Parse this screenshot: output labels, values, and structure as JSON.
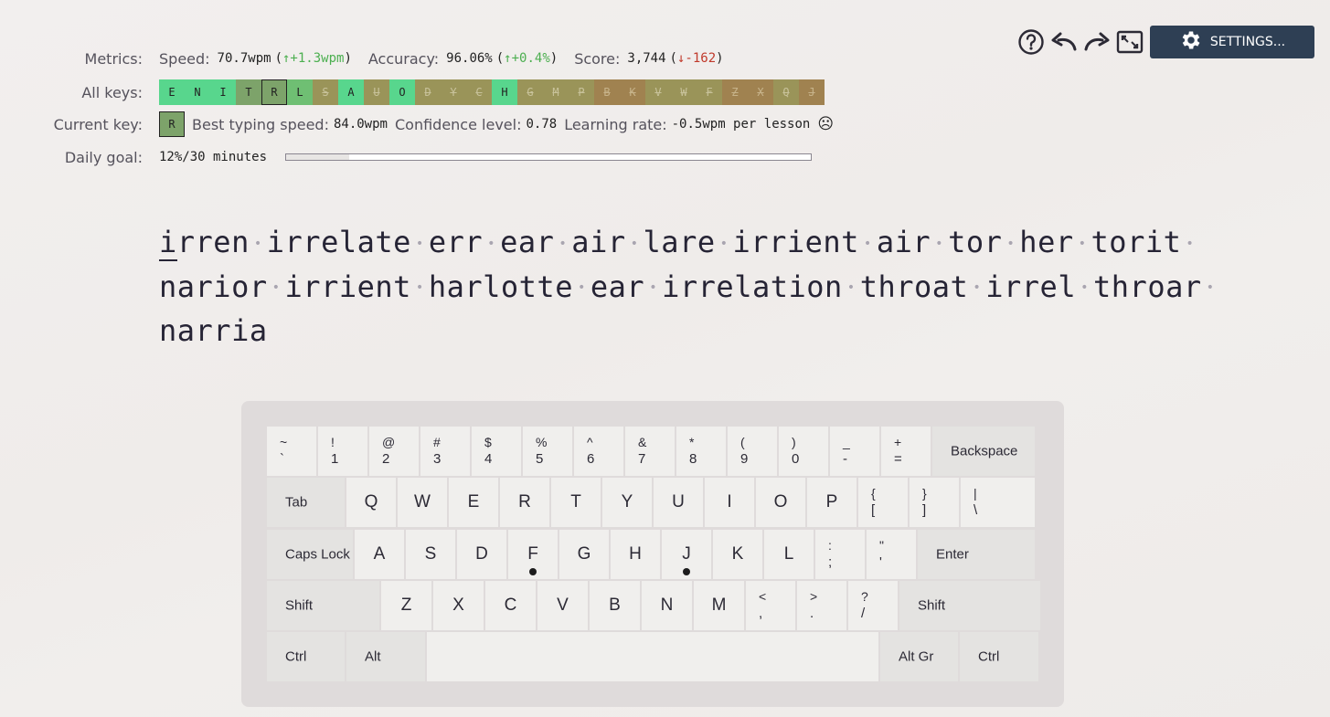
{
  "toolbar": {
    "help_icon": "question-circle-icon",
    "undo_icon": "undo-icon",
    "redo_icon": "redo-icon",
    "fullscreen_icon": "fullscreen-icon",
    "settings_label": "SETTINGS..."
  },
  "metrics": {
    "label": "Metrics:",
    "speed_label": "Speed:",
    "speed_value": "70.7wpm",
    "speed_delta": "↑+1.3wpm",
    "accuracy_label": "Accuracy:",
    "accuracy_value": "96.06%",
    "accuracy_delta": "↑+0.4%",
    "score_label": "Score:",
    "score_value": "3,744",
    "score_delta": "↓-162",
    "open_paren": "(",
    "close_paren": ")"
  },
  "all_keys": {
    "label": "All keys:",
    "keys": [
      "E",
      "N",
      "I",
      "T",
      "R",
      "L",
      "S",
      "A",
      "U",
      "O",
      "D",
      "Y",
      "C",
      "H",
      "G",
      "M",
      "P",
      "B",
      "K",
      "V",
      "W",
      "F",
      "Z",
      "X",
      "Q",
      "J"
    ]
  },
  "current_key": {
    "label": "Current key:",
    "key": "R",
    "best_speed_label": "Best typing speed:",
    "best_speed_value": "84.0wpm",
    "confidence_label": "Confidence level:",
    "confidence_value": "0.78",
    "learning_rate_label": "Learning rate:",
    "learning_rate_value": "-0.5wpm per lesson",
    "mood_icon": "☹"
  },
  "daily_goal": {
    "label": "Daily goal:",
    "value": "12%/30 minutes",
    "progress_fraction": 0.12
  },
  "lesson_text": {
    "line1": [
      "irren",
      "irrelate",
      "err",
      "ear",
      "air",
      "lare",
      "irrient",
      "air",
      "tor",
      "her",
      "torit"
    ],
    "line2": [
      "narior",
      "irrient",
      "harlotte",
      "ear",
      "irrelation",
      "throat",
      "irrel",
      "throar"
    ],
    "line3": [
      "narria"
    ],
    "separator": "•"
  },
  "keyboard": {
    "row1": [
      {
        "top": "~",
        "bot": "`"
      },
      {
        "top": "!",
        "bot": "1"
      },
      {
        "top": "@",
        "bot": "2"
      },
      {
        "top": "#",
        "bot": "3"
      },
      {
        "top": "$",
        "bot": "4"
      },
      {
        "top": "%",
        "bot": "5"
      },
      {
        "top": "^",
        "bot": "6"
      },
      {
        "top": "&",
        "bot": "7"
      },
      {
        "top": "*",
        "bot": "8"
      },
      {
        "top": "(",
        "bot": "9"
      },
      {
        "top": ")",
        "bot": "0"
      },
      {
        "top": "_",
        "bot": "-"
      },
      {
        "top": "+",
        "bot": "="
      }
    ],
    "backspace": "Backspace",
    "tab": "Tab",
    "row2": [
      "Q",
      "W",
      "E",
      "R",
      "T",
      "Y",
      "U",
      "I",
      "O",
      "P"
    ],
    "row2_sym": [
      {
        "top": "{",
        "bot": "["
      },
      {
        "top": "}",
        "bot": "]"
      },
      {
        "top": "|",
        "bot": "\\"
      }
    ],
    "caps": "Caps Lock",
    "row3": [
      "A",
      "S",
      "D",
      "F",
      "G",
      "H",
      "J",
      "K",
      "L"
    ],
    "row3_sym": [
      {
        "top": ":",
        "bot": ";"
      },
      {
        "top": "\"",
        "bot": "'"
      }
    ],
    "enter": "Enter",
    "shift_left": "Shift",
    "row4": [
      "Z",
      "X",
      "C",
      "V",
      "B",
      "N",
      "M"
    ],
    "row4_sym": [
      {
        "top": "<",
        "bot": ","
      },
      {
        "top": ">",
        "bot": "."
      },
      {
        "top": "?",
        "bot": "/"
      }
    ],
    "shift_right": "Shift",
    "ctrl_left": "Ctrl",
    "alt": "Alt",
    "altgr": "Alt Gr",
    "ctrl_right": "Ctrl"
  }
}
